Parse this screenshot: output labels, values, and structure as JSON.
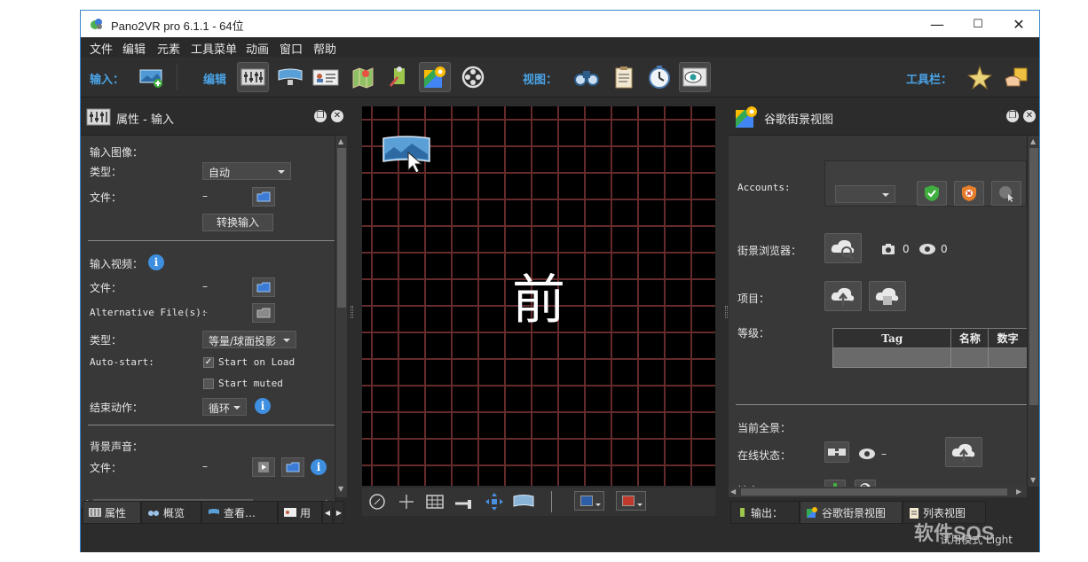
{
  "window": {
    "title": "Pano2VR pro 6.1.1 - 64位",
    "minimize": "—",
    "maximize": "☐",
    "close": "✕"
  },
  "menu": [
    "文件",
    "编辑",
    "元素",
    "工具菜单",
    "动画",
    "窗口",
    "帮助"
  ],
  "toolbar": {
    "input_label": "输入：",
    "edit_label": "编辑",
    "view_label": "视图：",
    "tools_label": "工具栏："
  },
  "left_panel": {
    "title": "属性 - 输入",
    "input_image": {
      "heading": "输入图像：",
      "type_label": "类型：",
      "type_value": "自动",
      "file_label": "文件：",
      "file_value": "–",
      "convert_button": "转换输入"
    },
    "input_video": {
      "heading": "输入视频：",
      "file_label": "文件：",
      "file_value": "–",
      "alt_files_label": "Alternative File(s):",
      "alt_files_value": "–",
      "type_label": "类型：",
      "type_value": "等量/球面投影",
      "autostart_label": "Auto-start:",
      "start_on_load": "Start on Load",
      "start_on_load_checked": true,
      "start_muted": "Start muted",
      "start_muted_checked": false,
      "end_action_label": "结束动作：",
      "end_action_value": "循环"
    },
    "background_sound": {
      "heading": "背景声音：",
      "file_label": "文件：",
      "file_value": "–"
    },
    "tabs": [
      "属性",
      "概览",
      "查看…",
      "用"
    ]
  },
  "viewer": {
    "center_text": "前"
  },
  "right_panel": {
    "title": "谷歌街景视图",
    "accounts_label": "Accounts:",
    "street_browser_label": "街景浏览器：",
    "photo_count": "0",
    "view_count": "0",
    "project_label": "项目：",
    "level_label": "等级：",
    "table_headers": [
      "Tag",
      "名称",
      "数字"
    ],
    "current_pano_label": "当前全景：",
    "online_status_label": "在线状态：",
    "online_status_value": "–",
    "location_label": "地点：",
    "tabs": [
      "输出：",
      "谷歌街景视图",
      "列表视图"
    ]
  },
  "status": {
    "text": "试用模式 Light"
  },
  "watermark": "软件SOS"
}
